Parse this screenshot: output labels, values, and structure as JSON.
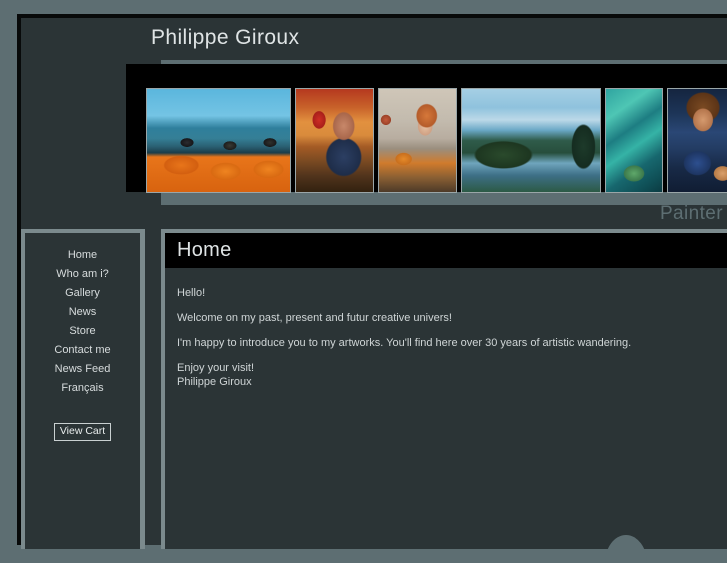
{
  "header": {
    "site_title": "Philippe Giroux",
    "tagline": "Painter"
  },
  "gallery": {
    "items": [
      {
        "name": "beach-orange-figures",
        "alt": "Three figures in orange coats with boots resting by the sea"
      },
      {
        "name": "chess-player",
        "alt": "Man playing chess at an orange table with a woman in red behind"
      },
      {
        "name": "woman-at-table",
        "alt": "Red-haired woman seated at a set dining table"
      },
      {
        "name": "coastal-landscape",
        "alt": "Forested headland beside a blue lake under a bright sky"
      },
      {
        "name": "teal-abstract",
        "alt": "Teal and green abstract composition with sail-like forms"
      },
      {
        "name": "guitarist-portrait",
        "alt": "Long-haired guitarist with moustache playing on a blue background"
      }
    ]
  },
  "sidebar": {
    "items": [
      {
        "label": "Home",
        "name": "sidebar-item-home"
      },
      {
        "label": "Who am i?",
        "name": "sidebar-item-who-am-i"
      },
      {
        "label": "Gallery",
        "name": "sidebar-item-gallery"
      },
      {
        "label": "News",
        "name": "sidebar-item-news"
      },
      {
        "label": "Store",
        "name": "sidebar-item-store"
      },
      {
        "label": "Contact me",
        "name": "sidebar-item-contact-me"
      },
      {
        "label": "News Feed",
        "name": "sidebar-item-news-feed"
      },
      {
        "label": "Français",
        "name": "sidebar-item-francais"
      }
    ],
    "view_cart_label": "View Cart"
  },
  "main": {
    "title": "Home",
    "paragraphs": [
      "Hello!",
      "Welcome on my past, present and futur creative univers!",
      "I'm happy to introduce you to my artworks. You'll find here over 30 years of artistic wandering.",
      "Enjoy your visit!",
      "Philippe Giroux"
    ]
  },
  "colors": {
    "page_background": "#5d6e72",
    "panel_background": "#2b3436",
    "panel_border": "#7b8a8d",
    "title_bar": "#000000",
    "text_primary": "#dfe4e5",
    "text_body": "#cfd5d6",
    "tagline": "#5d6e72"
  }
}
